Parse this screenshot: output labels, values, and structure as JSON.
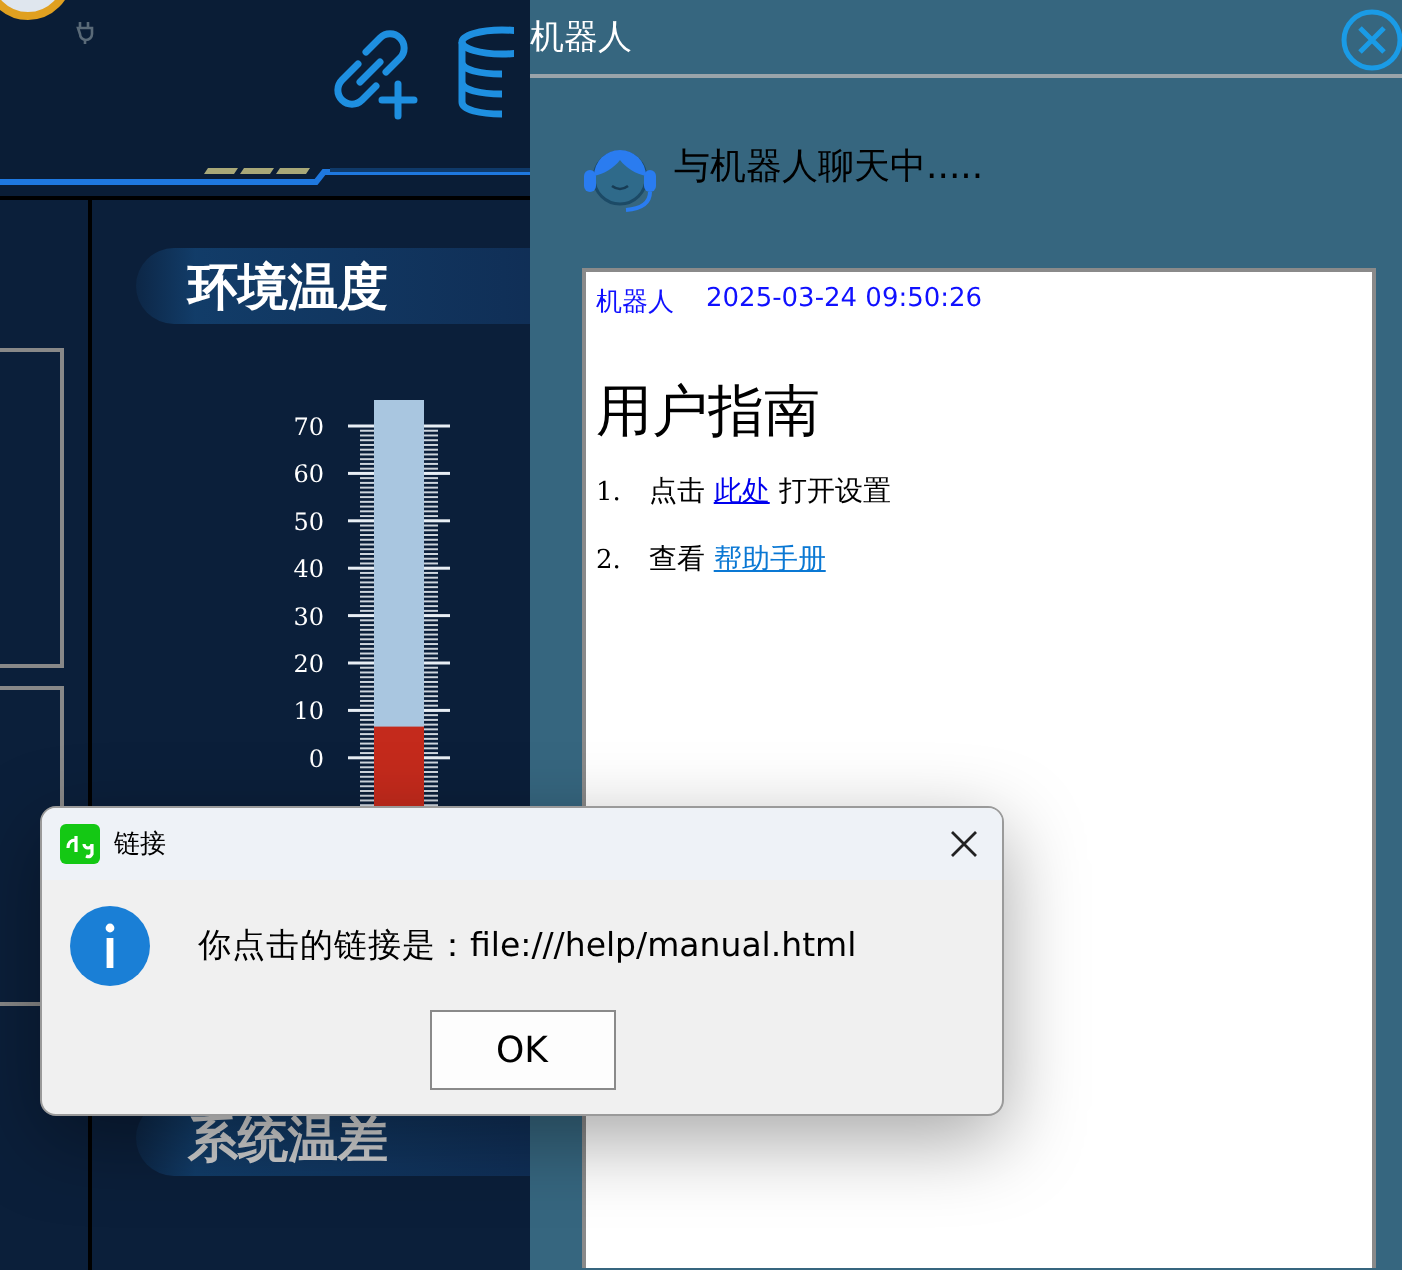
{
  "dashboard": {
    "sections": [
      {
        "title": "环境温度"
      },
      {
        "title": "系统温差"
      }
    ],
    "thermometer": {
      "ticks": [
        "70",
        "60",
        "50",
        "40",
        "30",
        "20",
        "10",
        "0"
      ],
      "level": 0.29
    }
  },
  "chat_window": {
    "title": "机器人",
    "status": "与机器人聊天中.....",
    "message": {
      "sender": "机器人",
      "time": "2025-03-24 09:50:26",
      "heading": "用户指南",
      "items": [
        {
          "number": "1.",
          "parts": [
            {
              "kind": "text",
              "text": "点击 "
            },
            {
              "kind": "link",
              "text": "此处",
              "color": "#0000ee"
            },
            {
              "kind": "text",
              "text": " 打开设置"
            }
          ]
        },
        {
          "number": "2.",
          "parts": [
            {
              "kind": "text",
              "text": "查看 "
            },
            {
              "kind": "link",
              "text": "帮助手册",
              "color": "#0a78d4"
            }
          ]
        }
      ]
    }
  },
  "dialog": {
    "title": "链接",
    "message": "你点击的链接是：file:///help/manual.html",
    "buttons": [
      "OK"
    ]
  }
}
